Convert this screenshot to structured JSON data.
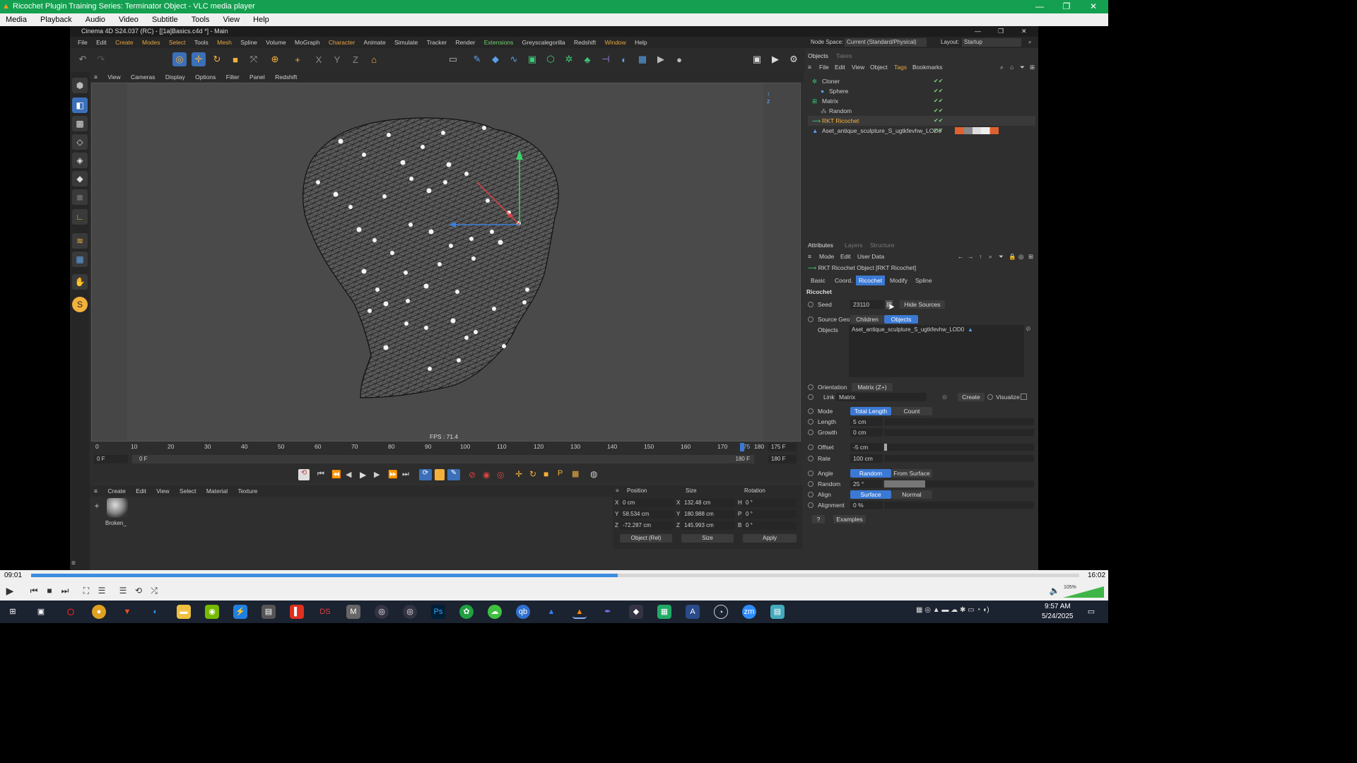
{
  "vlc": {
    "title": "Ricochet Plugin Training Series: Terminator Object - VLC media player",
    "menu": [
      "Media",
      "Playback",
      "Audio",
      "Video",
      "Subtitle",
      "Tools",
      "View",
      "Help"
    ],
    "time_elapsed": "09:01",
    "time_total": "16:02",
    "progress": 0.56,
    "volume": "105%"
  },
  "c4d": {
    "title": "Cinema 4D S24.037 (RC) - [[1a]Basics.c4d *] - Main",
    "menu": [
      "File",
      "Edit",
      "Create",
      "Modes",
      "Select",
      "Tools",
      "Mesh",
      "Spline",
      "Volume",
      "MoGraph",
      "Character",
      "Animate",
      "Simulate",
      "Tracker",
      "Render",
      "Extensions",
      "Greyscalegorilla",
      "Redshift",
      "Window",
      "Help"
    ],
    "viewport_menu": [
      "View",
      "Cameras",
      "Display",
      "Options",
      "Filter",
      "Panel",
      "Redshift"
    ],
    "fps": "FPS : 71.4",
    "timeline": {
      "ticks": [
        "0",
        "10",
        "20",
        "30",
        "40",
        "50",
        "60",
        "70",
        "80",
        "90",
        "100",
        "110",
        "120",
        "130",
        "140",
        "150",
        "160",
        "170",
        "175",
        "180"
      ],
      "current_frame": "175 F",
      "start": "0 F",
      "start2": "0 F",
      "end": "180 F",
      "end2": "180 F"
    },
    "material_menu": [
      "Create",
      "Edit",
      "View",
      "Select",
      "Material",
      "Texture"
    ],
    "material_name": "Broken_",
    "coords": {
      "headers": [
        "Position",
        "Size",
        "Rotation"
      ],
      "rows": [
        {
          "axis": "X",
          "pos": "0 cm",
          "saxis": "X",
          "size": "132.48 cm",
          "raxis": "H",
          "rot": "0 °"
        },
        {
          "axis": "Y",
          "pos": "58.534 cm",
          "saxis": "Y",
          "size": "180.988 cm",
          "raxis": "P",
          "rot": "0 °"
        },
        {
          "axis": "Z",
          "pos": "-72.287 cm",
          "saxis": "Z",
          "size": "145.993 cm",
          "raxis": "B",
          "rot": "0 °"
        }
      ],
      "mode": "Object (Rel)",
      "size_mode": "Size",
      "apply": "Apply"
    },
    "node_space_label": "Node Space:",
    "node_space_value": "Current (Standard/Physical)",
    "layout_label": "Layout:",
    "layout_value": "Startup",
    "objects_tabs": [
      "Objects",
      "Takes"
    ],
    "objects_menu": [
      "File",
      "Edit",
      "View",
      "Object",
      "Tags",
      "Bookmarks"
    ],
    "objects": [
      "Cloner",
      "Sphere",
      "Matrix",
      "Random",
      "RKT Ricochet",
      "Aset_antique_sculpture_S_ugtkfevhw_LOD0"
    ],
    "attr_tabs": [
      "Attributes",
      "Layers",
      "Structure"
    ],
    "attr_menu": [
      "Mode",
      "Edit",
      "User Data"
    ],
    "object_title": "RKT Ricochet Object [RKT Ricochet]",
    "attr_subtabs": [
      "Basic",
      "Coord.",
      "Ricochet",
      "Modify",
      "Spline"
    ],
    "section": "Ricochet",
    "seed_label": "Seed",
    "seed_value": "23110",
    "hide_sources": "Hide Sources",
    "source_geo_label": "Source Geo",
    "children": "Children",
    "objects_btn": "Objects",
    "objects_label": "Objects",
    "objects_value": "Aset_antique_sculpture_S_ugtkfevhw_LOD0",
    "orientation_label": "Orientation",
    "orientation_value": "Matrix (Z+)",
    "link_label": "Link",
    "link_value": "Matrix",
    "create": "Create",
    "visualize": "Visualize",
    "mode_label": "Mode",
    "total_length": "Total Length",
    "count": "Count",
    "length_label": "Length",
    "length_value": "5 cm",
    "growth_label": "Growth",
    "growth_value": "0 cm",
    "offset_label": "Offset",
    "offset_value": "-5 cm",
    "rate_label": "Rate",
    "rate_value": "100 cm",
    "angle_label": "Angle",
    "random_btn": "Random",
    "from_surface": "From Surface",
    "random_label": "Random",
    "random_value": "25 °",
    "align_label": "Align",
    "surface": "Surface",
    "normal": "Normal",
    "alignment_label": "Alignment",
    "alignment_value": "0 %",
    "help": "?",
    "examples": "Examples"
  },
  "taskbar": {
    "time": "9:57 AM",
    "date": "5/24/2025"
  }
}
